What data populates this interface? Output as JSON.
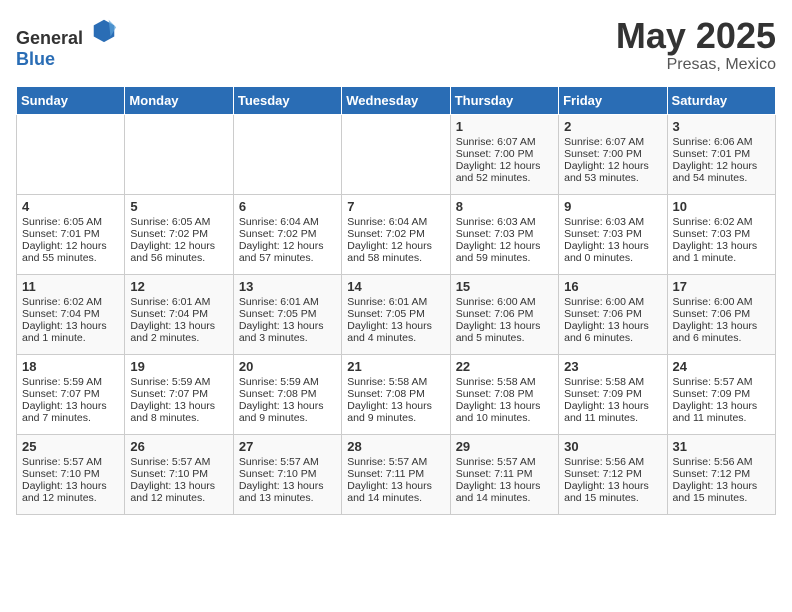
{
  "header": {
    "logo_general": "General",
    "logo_blue": "Blue",
    "title": "May 2025",
    "subtitle": "Presas, Mexico"
  },
  "days_of_week": [
    "Sunday",
    "Monday",
    "Tuesday",
    "Wednesday",
    "Thursday",
    "Friday",
    "Saturday"
  ],
  "weeks": [
    [
      {
        "day": "",
        "content": ""
      },
      {
        "day": "",
        "content": ""
      },
      {
        "day": "",
        "content": ""
      },
      {
        "day": "",
        "content": ""
      },
      {
        "day": "1",
        "content": "Sunrise: 6:07 AM\nSunset: 7:00 PM\nDaylight: 12 hours and 52 minutes."
      },
      {
        "day": "2",
        "content": "Sunrise: 6:07 AM\nSunset: 7:00 PM\nDaylight: 12 hours and 53 minutes."
      },
      {
        "day": "3",
        "content": "Sunrise: 6:06 AM\nSunset: 7:01 PM\nDaylight: 12 hours and 54 minutes."
      }
    ],
    [
      {
        "day": "4",
        "content": "Sunrise: 6:05 AM\nSunset: 7:01 PM\nDaylight: 12 hours and 55 minutes."
      },
      {
        "day": "5",
        "content": "Sunrise: 6:05 AM\nSunset: 7:02 PM\nDaylight: 12 hours and 56 minutes."
      },
      {
        "day": "6",
        "content": "Sunrise: 6:04 AM\nSunset: 7:02 PM\nDaylight: 12 hours and 57 minutes."
      },
      {
        "day": "7",
        "content": "Sunrise: 6:04 AM\nSunset: 7:02 PM\nDaylight: 12 hours and 58 minutes."
      },
      {
        "day": "8",
        "content": "Sunrise: 6:03 AM\nSunset: 7:03 PM\nDaylight: 12 hours and 59 minutes."
      },
      {
        "day": "9",
        "content": "Sunrise: 6:03 AM\nSunset: 7:03 PM\nDaylight: 13 hours and 0 minutes."
      },
      {
        "day": "10",
        "content": "Sunrise: 6:02 AM\nSunset: 7:03 PM\nDaylight: 13 hours and 1 minute."
      }
    ],
    [
      {
        "day": "11",
        "content": "Sunrise: 6:02 AM\nSunset: 7:04 PM\nDaylight: 13 hours and 1 minute."
      },
      {
        "day": "12",
        "content": "Sunrise: 6:01 AM\nSunset: 7:04 PM\nDaylight: 13 hours and 2 minutes."
      },
      {
        "day": "13",
        "content": "Sunrise: 6:01 AM\nSunset: 7:05 PM\nDaylight: 13 hours and 3 minutes."
      },
      {
        "day": "14",
        "content": "Sunrise: 6:01 AM\nSunset: 7:05 PM\nDaylight: 13 hours and 4 minutes."
      },
      {
        "day": "15",
        "content": "Sunrise: 6:00 AM\nSunset: 7:06 PM\nDaylight: 13 hours and 5 minutes."
      },
      {
        "day": "16",
        "content": "Sunrise: 6:00 AM\nSunset: 7:06 PM\nDaylight: 13 hours and 6 minutes."
      },
      {
        "day": "17",
        "content": "Sunrise: 6:00 AM\nSunset: 7:06 PM\nDaylight: 13 hours and 6 minutes."
      }
    ],
    [
      {
        "day": "18",
        "content": "Sunrise: 5:59 AM\nSunset: 7:07 PM\nDaylight: 13 hours and 7 minutes."
      },
      {
        "day": "19",
        "content": "Sunrise: 5:59 AM\nSunset: 7:07 PM\nDaylight: 13 hours and 8 minutes."
      },
      {
        "day": "20",
        "content": "Sunrise: 5:59 AM\nSunset: 7:08 PM\nDaylight: 13 hours and 9 minutes."
      },
      {
        "day": "21",
        "content": "Sunrise: 5:58 AM\nSunset: 7:08 PM\nDaylight: 13 hours and 9 minutes."
      },
      {
        "day": "22",
        "content": "Sunrise: 5:58 AM\nSunset: 7:08 PM\nDaylight: 13 hours and 10 minutes."
      },
      {
        "day": "23",
        "content": "Sunrise: 5:58 AM\nSunset: 7:09 PM\nDaylight: 13 hours and 11 minutes."
      },
      {
        "day": "24",
        "content": "Sunrise: 5:57 AM\nSunset: 7:09 PM\nDaylight: 13 hours and 11 minutes."
      }
    ],
    [
      {
        "day": "25",
        "content": "Sunrise: 5:57 AM\nSunset: 7:10 PM\nDaylight: 13 hours and 12 minutes."
      },
      {
        "day": "26",
        "content": "Sunrise: 5:57 AM\nSunset: 7:10 PM\nDaylight: 13 hours and 12 minutes."
      },
      {
        "day": "27",
        "content": "Sunrise: 5:57 AM\nSunset: 7:10 PM\nDaylight: 13 hours and 13 minutes."
      },
      {
        "day": "28",
        "content": "Sunrise: 5:57 AM\nSunset: 7:11 PM\nDaylight: 13 hours and 14 minutes."
      },
      {
        "day": "29",
        "content": "Sunrise: 5:57 AM\nSunset: 7:11 PM\nDaylight: 13 hours and 14 minutes."
      },
      {
        "day": "30",
        "content": "Sunrise: 5:56 AM\nSunset: 7:12 PM\nDaylight: 13 hours and 15 minutes."
      },
      {
        "day": "31",
        "content": "Sunrise: 5:56 AM\nSunset: 7:12 PM\nDaylight: 13 hours and 15 minutes."
      }
    ]
  ]
}
